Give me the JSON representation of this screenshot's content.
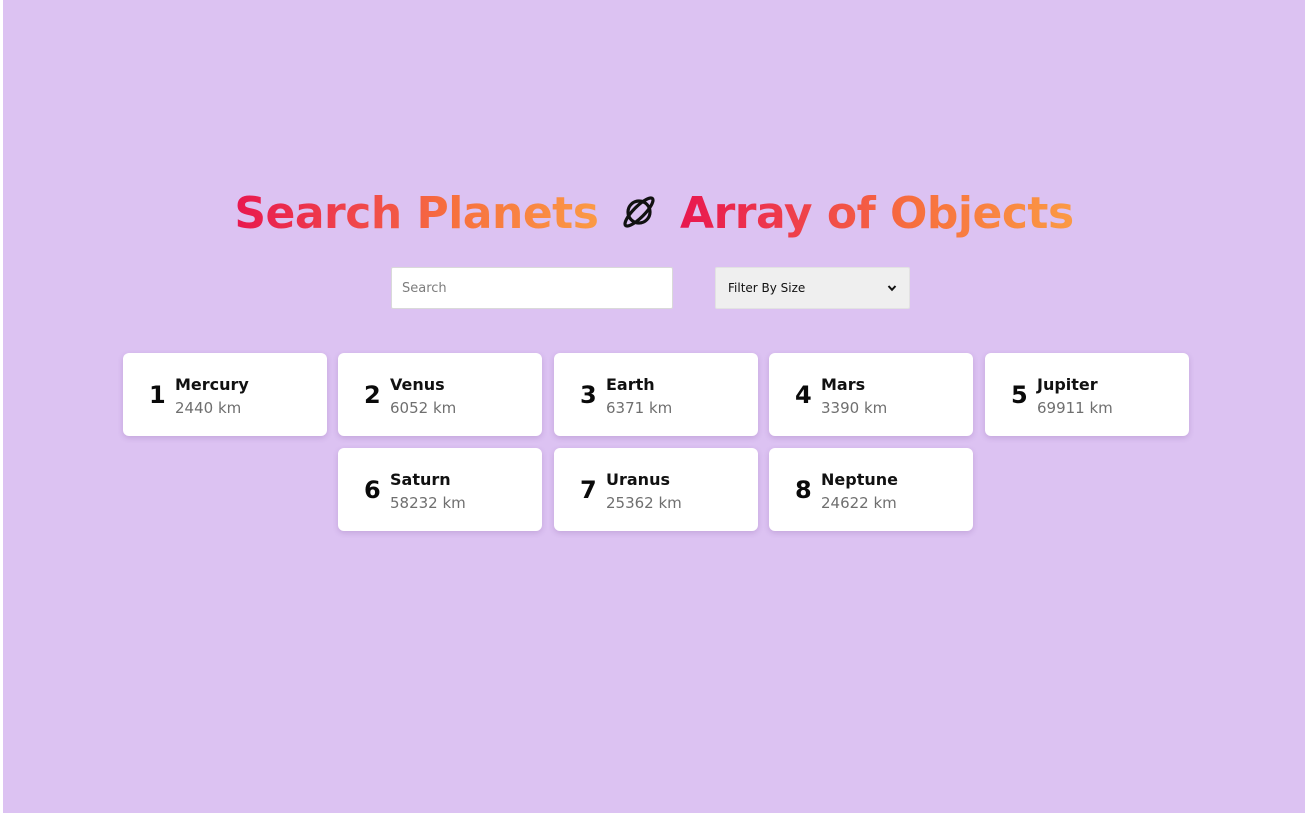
{
  "header": {
    "title_part1": "Search Planets",
    "title_icon": "planet-icon",
    "title_part2": "Array of Objects"
  },
  "search": {
    "placeholder": "Search",
    "value": ""
  },
  "filter": {
    "selected": "Filter By Size"
  },
  "planets": [
    {
      "num": "1",
      "name": "Mercury",
      "size": "2440 km"
    },
    {
      "num": "2",
      "name": "Venus",
      "size": "6052 km"
    },
    {
      "num": "3",
      "name": "Earth",
      "size": "6371 km"
    },
    {
      "num": "4",
      "name": "Mars",
      "size": "3390 km"
    },
    {
      "num": "5",
      "name": "Jupiter",
      "size": "69911 km"
    },
    {
      "num": "6",
      "name": "Saturn",
      "size": "58232 km"
    },
    {
      "num": "7",
      "name": "Uranus",
      "size": "25362 km"
    },
    {
      "num": "8",
      "name": "Neptune",
      "size": "24622 km"
    }
  ],
  "colors": {
    "background": "#dcc2f2",
    "title_gradient_start": "#e8174f",
    "title_gradient_end": "#fb9a45"
  }
}
